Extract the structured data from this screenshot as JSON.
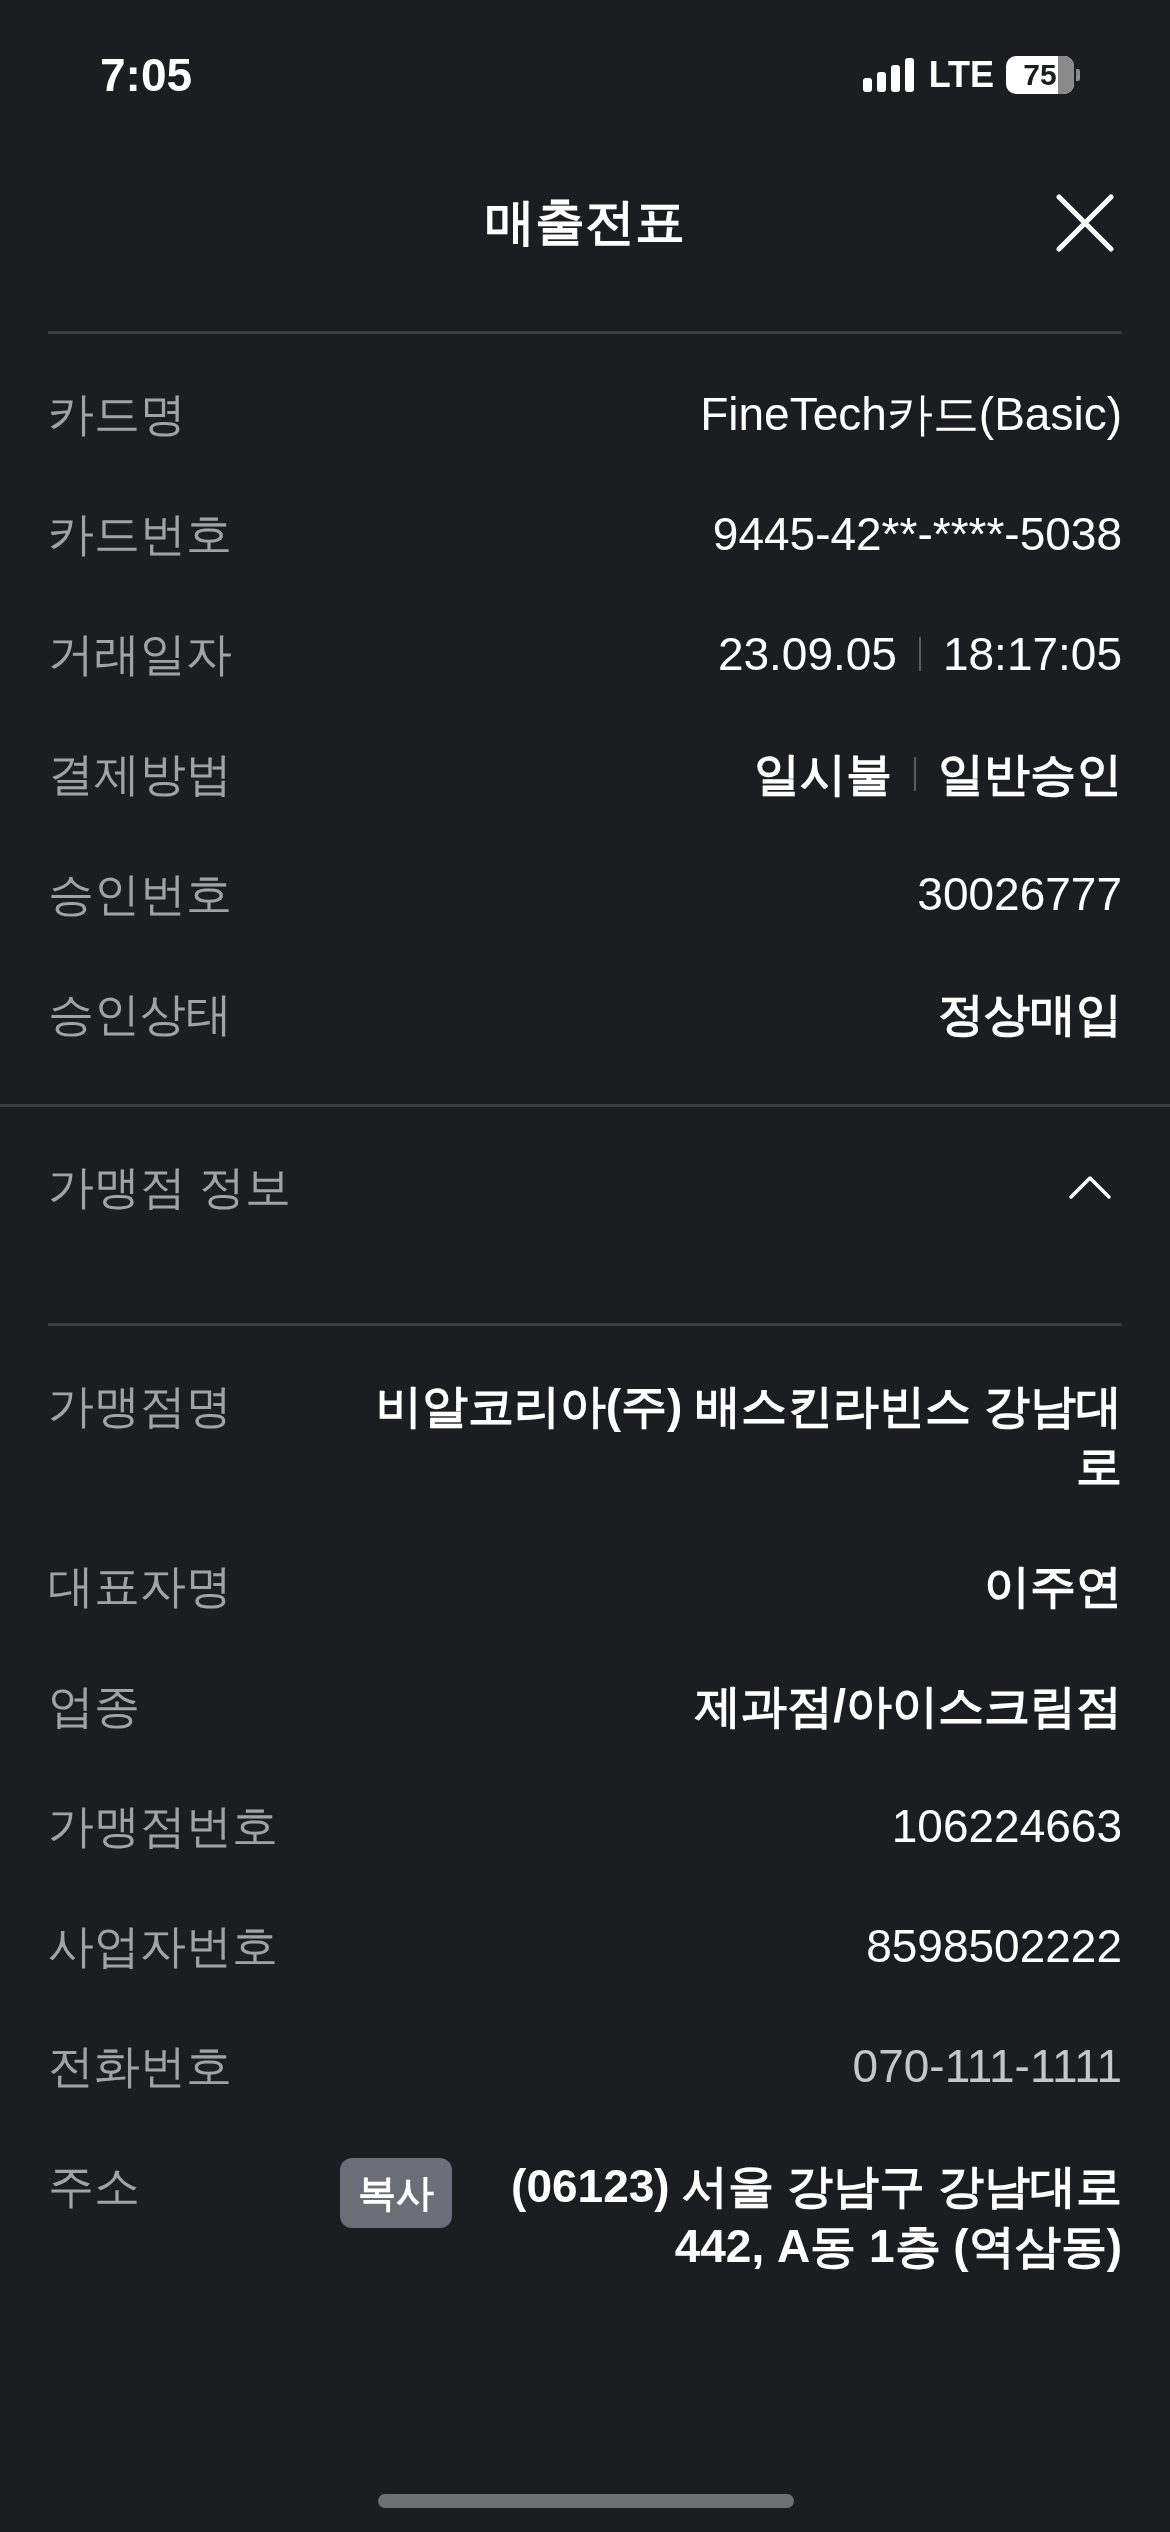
{
  "status_bar": {
    "time": "7:05",
    "network": "LTE",
    "battery": "75"
  },
  "header": {
    "title": "매출전표"
  },
  "transaction": [
    {
      "label": "카드명",
      "kind": "text",
      "bold": false,
      "values": [
        "FineTech카드(Basic)"
      ]
    },
    {
      "label": "카드번호",
      "kind": "text",
      "bold": false,
      "values": [
        "9445-42**-****-5038"
      ]
    },
    {
      "label": "거래일자",
      "kind": "text",
      "bold": false,
      "values": [
        "23.09.05",
        "18:17:05"
      ]
    },
    {
      "label": "결제방법",
      "kind": "text",
      "bold": true,
      "values": [
        "일시불",
        "일반승인"
      ]
    },
    {
      "label": "승인번호",
      "kind": "text",
      "bold": false,
      "values": [
        "30026777"
      ]
    },
    {
      "label": "승인상태",
      "kind": "text",
      "bold": true,
      "values": [
        "정상매입"
      ]
    }
  ],
  "merchant_section": {
    "title": "가맹점 정보",
    "expanded": true,
    "rows": [
      {
        "label": "가맹점명",
        "kind": "text",
        "bold": true,
        "values": [
          "비알코리아(주) 배스킨라빈스 강남대로"
        ]
      },
      {
        "label": "대표자명",
        "kind": "text",
        "bold": true,
        "values": [
          "이주연"
        ]
      },
      {
        "label": "업종",
        "kind": "text",
        "bold": true,
        "values": [
          "제과점/아이스크림점"
        ]
      },
      {
        "label": "가맹점번호",
        "kind": "text",
        "bold": false,
        "values": [
          "106224663"
        ]
      },
      {
        "label": "사업자번호",
        "kind": "text",
        "bold": false,
        "values": [
          "8598502222"
        ]
      },
      {
        "label": "전화번호",
        "kind": "phone",
        "bold": false,
        "values": [
          "070-111-1111"
        ]
      },
      {
        "label": "주소",
        "kind": "address",
        "bold": true,
        "copy_button": "복사",
        "values": [
          "(06123) 서울 강남구 강남대로 442, A동 1층 (역삼동)"
        ]
      }
    ]
  }
}
